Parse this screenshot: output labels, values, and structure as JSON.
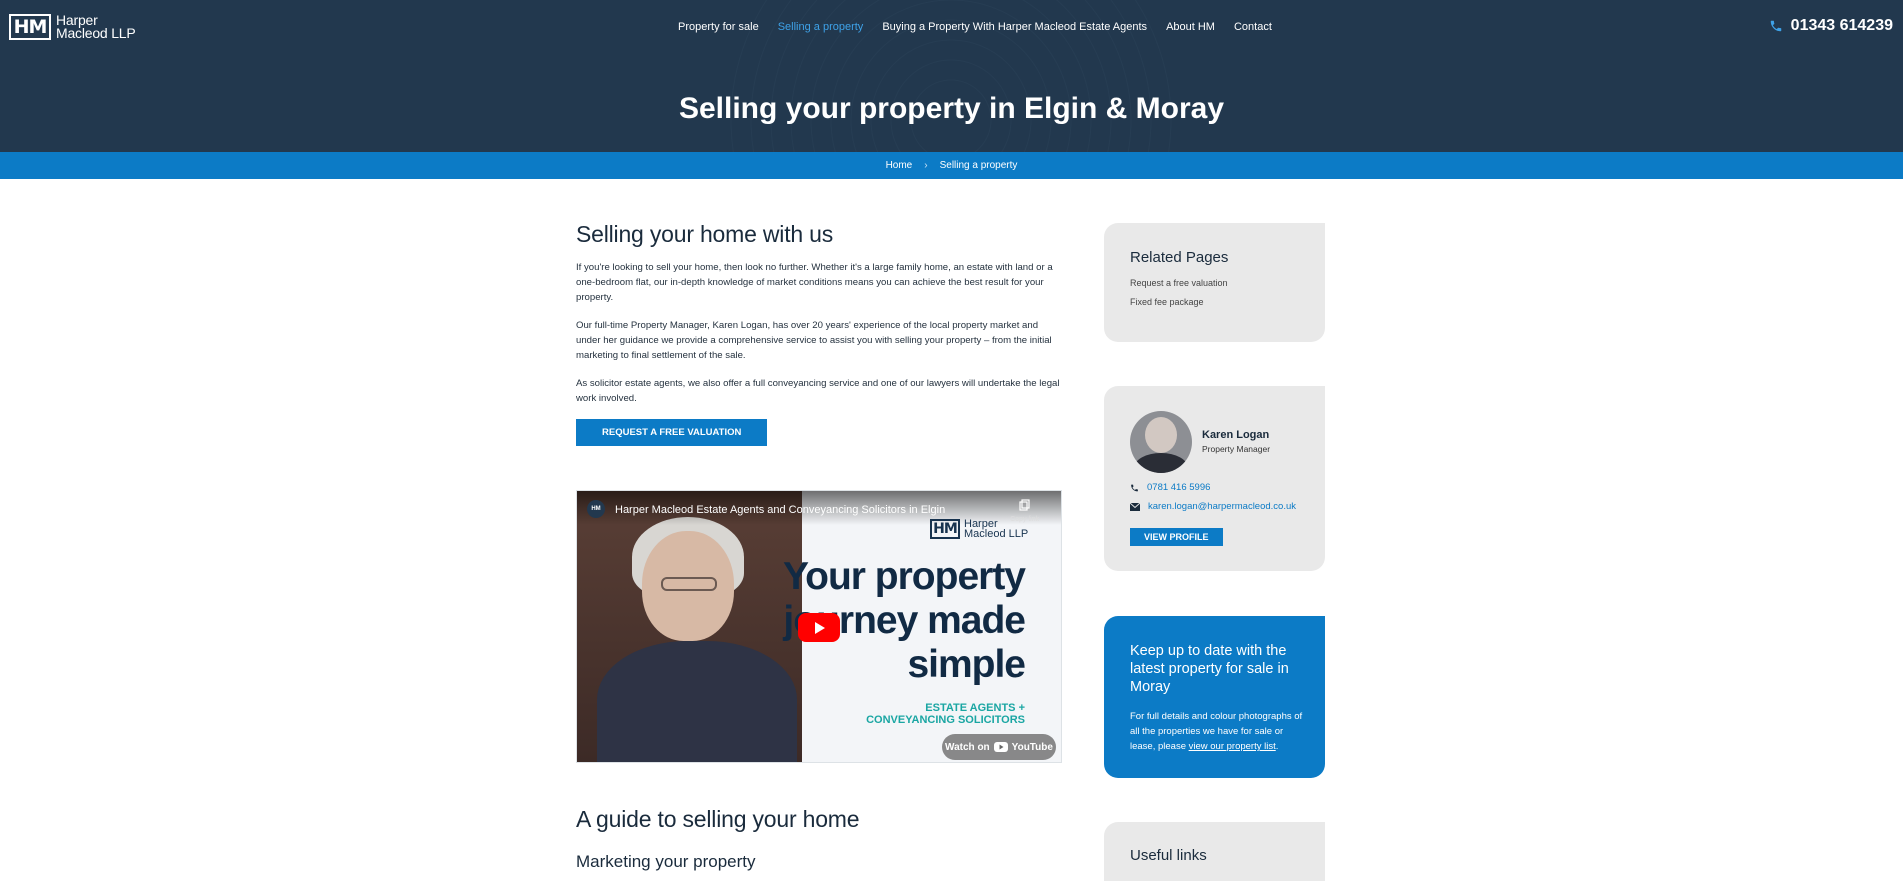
{
  "header": {
    "logo_mark": "HM",
    "logo_line1": "Harper",
    "logo_line2": "Macleod LLP",
    "nav": [
      {
        "label": "Property for sale"
      },
      {
        "label": "Selling a property"
      },
      {
        "label": "Buying a Property With Harper Macleod Estate Agents"
      },
      {
        "label": "About HM"
      },
      {
        "label": "Contact"
      }
    ],
    "active_nav": "Selling a property",
    "phone": "01343 614239",
    "hero_title": "Selling your property in Elgin & Moray"
  },
  "breadcrumb": {
    "home": "Home",
    "separator": "›",
    "current": "Selling a property"
  },
  "main": {
    "heading": "Selling your home with us",
    "paragraphs": [
      "If you're looking to sell your home, then look no further. Whether it's a large family home, an estate with land or a one-bedroom flat, our in-depth knowledge of market conditions means you can achieve the best result for your property.",
      "Our full-time Property Manager, Karen Logan, has over 20 years' experience of the local property market and under her guidance we provide a comprehensive service to assist you with selling your property – from the initial marketing to final settlement of the sale.",
      "As solicitor estate agents, we also offer a full conveyancing service and one of our lawyers will undertake the legal work involved."
    ],
    "cta_label": "REQUEST A FREE VALUATION",
    "video": {
      "channel_badge": "HM",
      "title": "Harper Macleod Estate Agents and Conveyancing Solicitors in Elgin",
      "copy_label": "Copy link",
      "logo_mark": "HM",
      "logo_line1": "Harper",
      "logo_line2": "Macleod LLP",
      "headline_1": "Your property",
      "headline_2": "journey made",
      "headline_3": "simple",
      "tag_1": "ESTATE AGENTS +",
      "tag_2": "CONVEYANCING SOLICITORS",
      "watch_on": "Watch on",
      "youtube": "YouTube"
    },
    "guide_heading": "A guide to selling your home",
    "sub_heading": "Marketing your property"
  },
  "sidebar": {
    "related": {
      "title": "Related Pages",
      "links": [
        "Request a free valuation",
        "Fixed fee package"
      ]
    },
    "contact": {
      "name": "Karen Logan",
      "role": "Property Manager",
      "phone": "0781 416 5996",
      "email": "karen.logan@harpermacleod.co.uk",
      "button": "VIEW PROFILE"
    },
    "promo": {
      "title": "Keep up to date with the latest property for sale in Moray",
      "text": "For full details and colour photographs of all the properties we have for sale or lease, please ",
      "link": "view our property list",
      "after": "."
    },
    "useful": {
      "title": "Useful links"
    }
  },
  "colors": {
    "header_bg": "#22384e",
    "accent_blue": "#0c7bc6",
    "nav_active": "#3ea2e8",
    "card_grey": "#e9e9e9"
  }
}
